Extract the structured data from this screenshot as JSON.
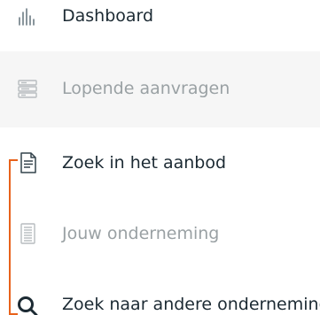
{
  "nav": {
    "items": [
      {
        "label": "Dashboard",
        "icon": "bar-chart-icon",
        "state": "active"
      },
      {
        "label": "Lopende aanvragen",
        "icon": "requests-list-icon",
        "state": "disabled"
      },
      {
        "label": "Zoek in het aanbod",
        "icon": "document-icon",
        "state": "active"
      },
      {
        "label": "Jouw onderneming",
        "icon": "company-document-icon",
        "state": "disabled"
      },
      {
        "label": "Zoek naar andere onderneming",
        "icon": "search-icon",
        "state": "active"
      }
    ]
  },
  "colors": {
    "active_text": "#1c2a33",
    "disabled_text": "#9aa1a4",
    "highlight_background": "#f6f6f6",
    "accent_line": "#e8621b"
  }
}
